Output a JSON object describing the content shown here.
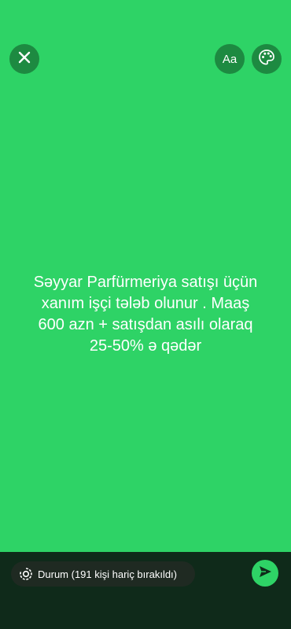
{
  "status": {
    "background_color": "#2ed366",
    "lines": [
      "Səyyar Parfürmeriya satışı üçün",
      "xanım işçi tələb olunur . Maaş",
      "600 azn + satışdan asılı olaraq",
      "25-50% ə qədər"
    ]
  },
  "toolbar": {
    "close_icon": "close-icon",
    "font_button_label": "Aa",
    "palette_icon": "palette-icon"
  },
  "footer": {
    "audience_label": "Durum (191 kişi hariç bırakıldı)",
    "audience_icon": "status-ring-icon",
    "send_icon": "send-icon"
  }
}
